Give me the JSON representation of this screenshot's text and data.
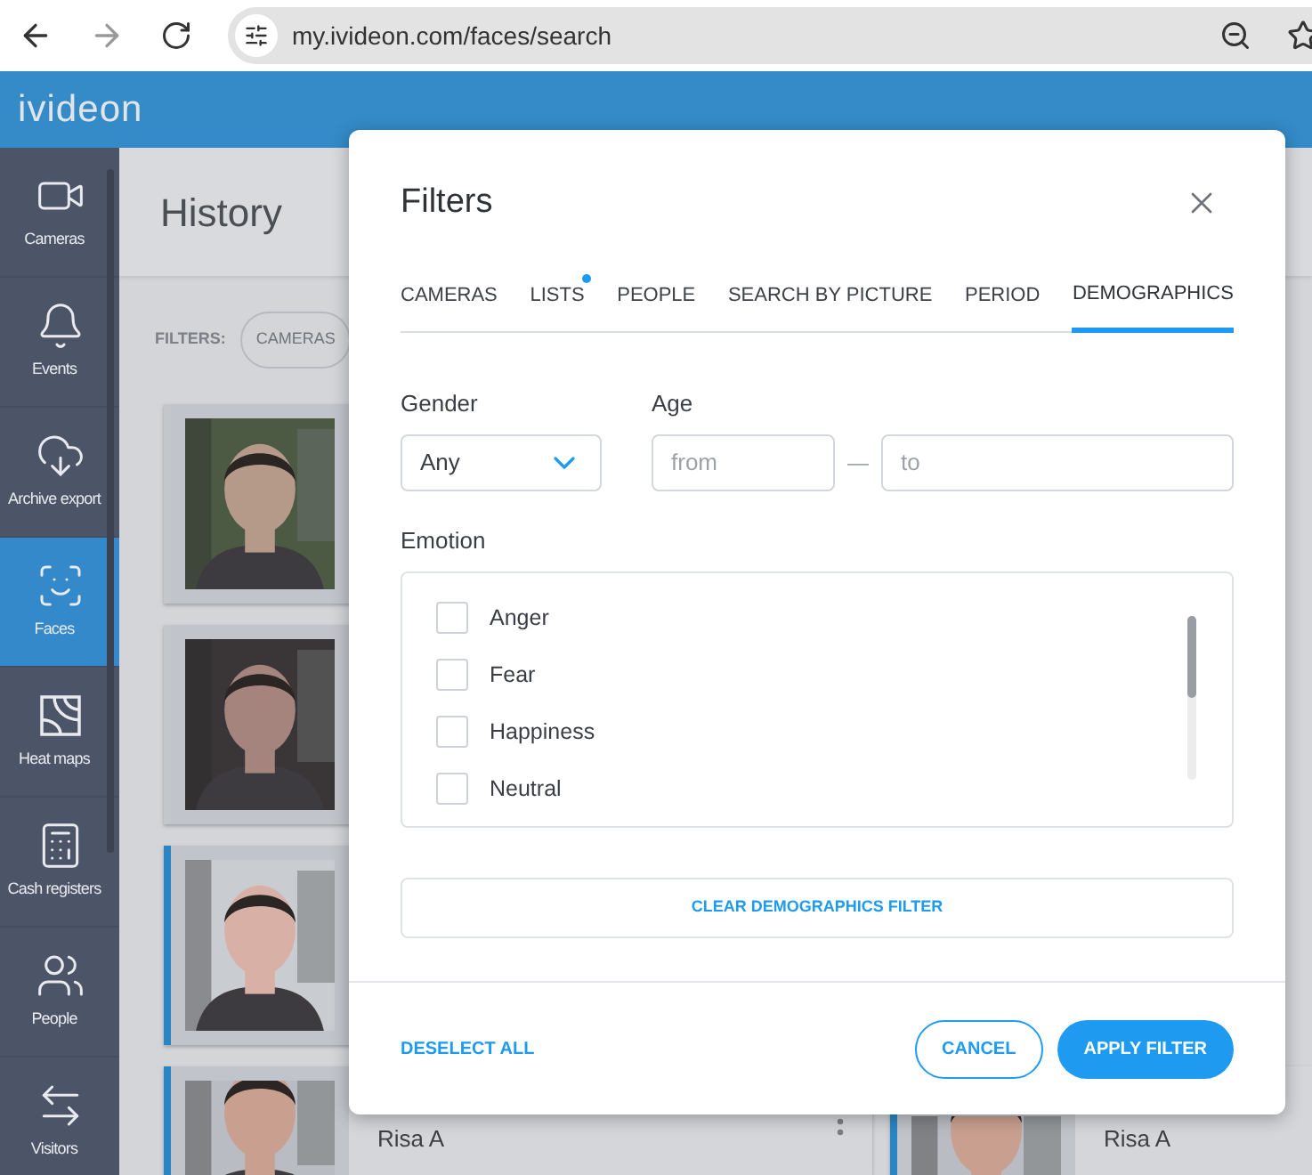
{
  "browser": {
    "url": "my.ivideon.com/faces/search"
  },
  "app": {
    "logo": "ivideon"
  },
  "sidebar": {
    "items": [
      {
        "label": "Cameras",
        "selected": false
      },
      {
        "label": "Events",
        "selected": false
      },
      {
        "label": "Archive export",
        "selected": false
      },
      {
        "label": "Faces",
        "selected": true
      },
      {
        "label": "Heat maps",
        "selected": false
      },
      {
        "label": "Cash registers",
        "selected": false
      },
      {
        "label": "People",
        "selected": false
      },
      {
        "label": "Visitors",
        "selected": false
      }
    ]
  },
  "page": {
    "title": "History",
    "filters_label": "FILTERS:",
    "filter_chip": "CAMERAS"
  },
  "cards": [
    {
      "kind": "picture",
      "marked": false
    },
    {
      "kind": "picture",
      "marked": false
    },
    {
      "kind": "picture",
      "marked": true
    },
    {
      "kind": "picture",
      "marked": true,
      "name": "Risa A"
    }
  ],
  "right_cards": [
    {
      "kind": "picture",
      "marked": true,
      "name": "Risa A"
    }
  ],
  "dialog": {
    "title": "Filters",
    "tabs": [
      {
        "label": "CAMERAS",
        "selected": false,
        "dot": false
      },
      {
        "label": "LISTS",
        "selected": false,
        "dot": true
      },
      {
        "label": "PEOPLE",
        "selected": false,
        "dot": false
      },
      {
        "label": "SEARCH BY PICTURE",
        "selected": false,
        "dot": false
      },
      {
        "label": "PERIOD",
        "selected": false,
        "dot": false
      },
      {
        "label": "DEMOGRAPHICS",
        "selected": true,
        "dot": false
      }
    ],
    "gender": {
      "label": "Gender",
      "value": "Any"
    },
    "age": {
      "label": "Age",
      "from": {
        "placeholder": "from"
      },
      "separator": "—",
      "to": {
        "placeholder": "to"
      }
    },
    "emotion": {
      "label": "Emotion",
      "options": [
        {
          "label": "Anger",
          "checked": false
        },
        {
          "label": "Fear",
          "checked": false
        },
        {
          "label": "Happiness",
          "checked": false
        },
        {
          "label": "Neutral",
          "checked": false
        }
      ]
    },
    "clear_button": "CLEAR DEMOGRAPHICS FILTER",
    "deselect_all": "DESELECT ALL",
    "cancel": "CANCEL",
    "apply": "APPLY FILTER"
  }
}
